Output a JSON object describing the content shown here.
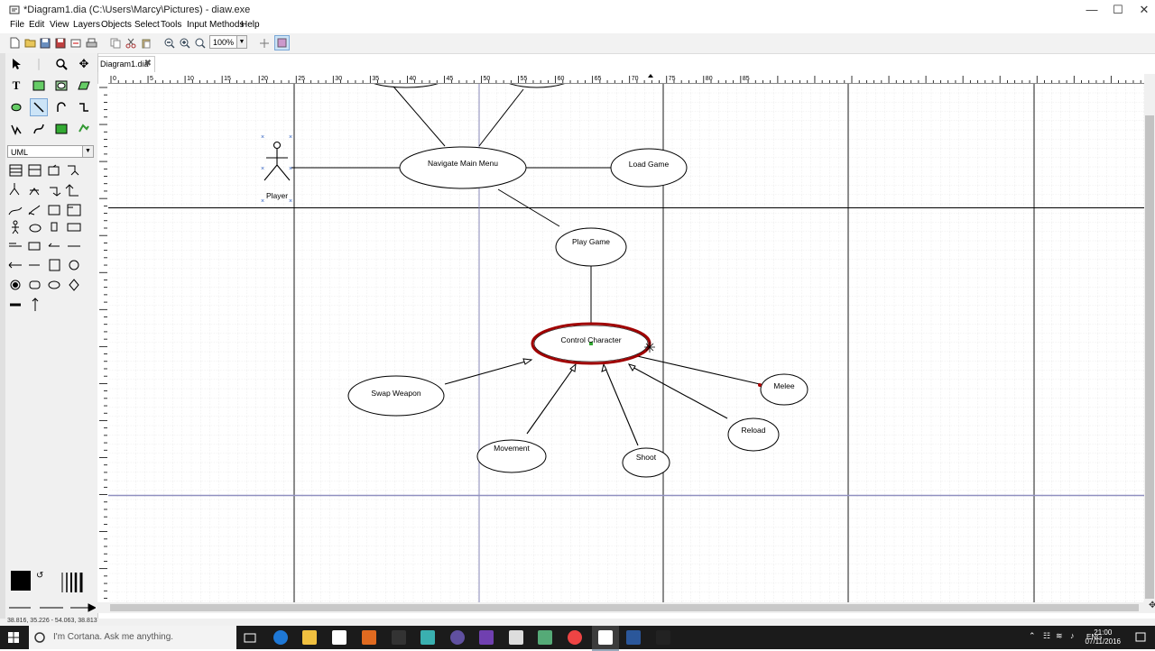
{
  "window": {
    "title": "*Diagram1.dia (C:\\Users\\Marcy\\Pictures) - diaw.exe"
  },
  "menu": [
    {
      "label": "File"
    },
    {
      "label": "Edit"
    },
    {
      "label": "View"
    },
    {
      "label": "Layers"
    },
    {
      "label": "Objects"
    },
    {
      "label": "Select"
    },
    {
      "label": "Tools"
    },
    {
      "label": "Input Methods"
    },
    {
      "label": "Help"
    }
  ],
  "toolbar": {
    "zoom": "100%"
  },
  "toolbox": {
    "sheet": "UML"
  },
  "tab": {
    "label": "Diagram1.dia"
  },
  "ruler": {
    "h_labels": [
      "0",
      "5",
      "10",
      "15",
      "20",
      "25",
      "30",
      "35",
      "40",
      "45",
      "50",
      "55",
      "60",
      "65",
      "70",
      "75",
      "80",
      "85"
    ]
  },
  "diagram": {
    "actor": {
      "label": "Player"
    },
    "usecases": {
      "navigate": "Navigate Main Menu",
      "load": "Load Game",
      "play": "Play Game",
      "control": "Control Character",
      "swap": "Swap Weapon",
      "movement": "Movement",
      "shoot": "Shoot",
      "reload": "Reload",
      "melee": "Melee"
    }
  },
  "status": {
    "coords": "38.816, 35.226 - 54.063, 38.813"
  },
  "taskbar": {
    "search_placeholder": "I'm Cortana. Ask me anything.",
    "lang": "ENG",
    "time": "21:00",
    "date": "07/11/2016"
  },
  "colors": {
    "selection": "#a00000",
    "taskbar": "#1b1b1b",
    "tool_selected": "#cce4f7"
  }
}
